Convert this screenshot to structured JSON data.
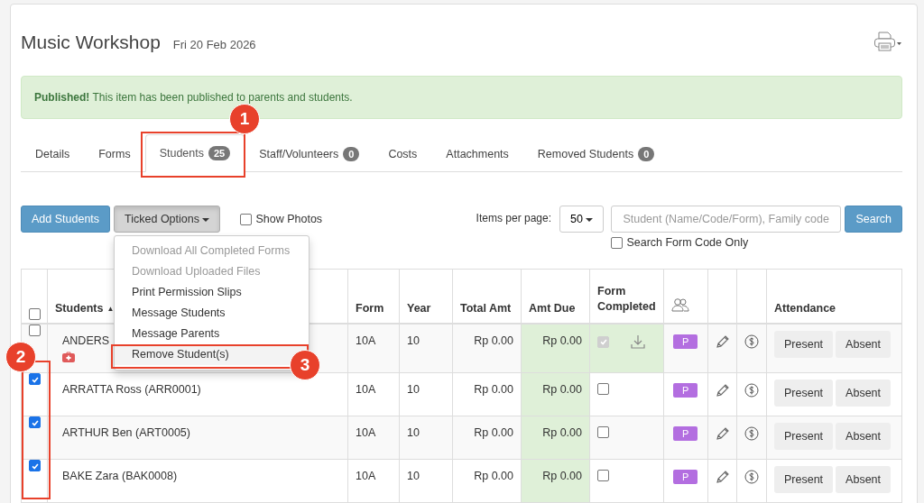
{
  "title": "Music Workshop",
  "date": "Fri 20 Feb 2026",
  "alert": "**Published!** This item has been published to parents and students.",
  "tabs": [
    {
      "label": "Details",
      "selected": false
    },
    {
      "label": "Forms",
      "selected": false
    },
    {
      "label": "Students",
      "badge": "25",
      "selected": true
    },
    {
      "label": "Staff/Volunteers",
      "badge": "0",
      "selected": false
    },
    {
      "label": "Costs",
      "selected": false
    },
    {
      "label": "Attachments",
      "selected": false
    },
    {
      "label": "Removed Students",
      "badge": "0",
      "selected": false
    }
  ],
  "toolbar": {
    "add_button": "Add Students",
    "options_button": {
      "label": "Ticked Options",
      "expanded": true
    },
    "show_photos": {
      "label": "Show Photos",
      "checked": false
    },
    "items_per_page": {
      "label": "Items per page:",
      "value": "50"
    },
    "search": {
      "placeholder": "Student (Name/Code/Form), Family code",
      "button": "Search"
    },
    "form_code_only": {
      "label": "Search Form Code Only",
      "checked": false
    }
  },
  "menu": [
    {
      "label": "Download All Completed Forms",
      "disabled": true,
      "highlighted": false
    },
    {
      "label": "Download Uploaded Files",
      "disabled": true,
      "highlighted": false
    },
    {
      "label": "Print Permission Slips",
      "disabled": false,
      "highlighted": false
    },
    {
      "label": "Message Students",
      "disabled": false,
      "highlighted": false
    },
    {
      "label": "Message Parents",
      "disabled": false,
      "highlighted": false
    },
    {
      "label": "Remove Student(s)",
      "disabled": false,
      "highlighted": true
    }
  ],
  "table": {
    "header_checked": false,
    "columns": [
      {
        "label": "Students",
        "sort": "▲"
      },
      {
        "label": "Form"
      },
      {
        "label": "Year"
      },
      {
        "label": "Total Amt"
      },
      {
        "label": "Amt Due"
      },
      {
        "label": "Form Completed"
      },
      {
        "label": "Attendance"
      }
    ],
    "rows": [
      {
        "checked": false,
        "name": "ANDERS",
        "medical": true,
        "form": "10A",
        "year": "10",
        "total": "Rp 0.00",
        "due": "Rp 0.00",
        "form_completed": true,
        "badge": "P",
        "present": "Present",
        "absent": "Absent"
      },
      {
        "checked": true,
        "name": "ARRATTA Ross (ARR0001)",
        "medical": false,
        "form": "10A",
        "year": "10",
        "total": "Rp 0.00",
        "due": "Rp 0.00",
        "form_completed": false,
        "badge": "P",
        "present": "Present",
        "absent": "Absent"
      },
      {
        "checked": true,
        "name": "ARTHUR Ben (ART0005)",
        "medical": false,
        "form": "10A",
        "year": "10",
        "total": "Rp 0.00",
        "due": "Rp 0.00",
        "form_completed": false,
        "badge": "P",
        "present": "Present",
        "absent": "Absent"
      },
      {
        "checked": true,
        "name": "BAKE Zara (BAK0008)",
        "medical": false,
        "form": "10A",
        "year": "10",
        "total": "Rp 0.00",
        "due": "Rp 0.00",
        "form_completed": false,
        "badge": "P",
        "present": "Present",
        "absent": "Absent"
      }
    ]
  },
  "callouts": [
    {
      "number": "1"
    },
    {
      "number": "2"
    },
    {
      "number": "3"
    }
  ]
}
